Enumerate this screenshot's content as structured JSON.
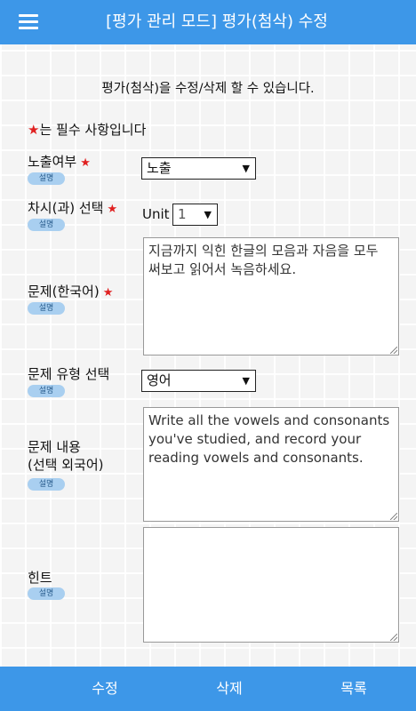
{
  "header": {
    "title": "[평가 관리 모드] 평가(첨삭) 수정",
    "menu_icon": "hamburger-menu-icon"
  },
  "intro_text": "평가(첨삭)을 수정/삭제 할 수 있습니다.",
  "required_note": {
    "star": "★",
    "text": "는 필수 사항입니다"
  },
  "help_label": "설명",
  "fields": {
    "exposure": {
      "label": "노출여부",
      "star": "★",
      "value": "노출"
    },
    "lesson": {
      "label": "차시(과) 선택",
      "star": "★",
      "unit_label": "Unit",
      "value": "1"
    },
    "question_ko": {
      "label": "문제(한국어)",
      "star": "★",
      "value": "지금까지 익힌 한글의 모음과 자음을 모두 써보고 읽어서 녹음하세요."
    },
    "question_type": {
      "label": "문제 유형 선택",
      "value": "영어"
    },
    "question_content": {
      "label_line1": "문제 내용",
      "label_line2": "(선택 외국어)",
      "value": "Write all the vowels and consonants you've studied, and record your reading vowels and consonants."
    },
    "hint": {
      "label": "힌트",
      "value": ""
    }
  },
  "dropdown_arrow": "▼",
  "footer": {
    "edit": "수정",
    "delete": "삭제",
    "list": "목록"
  },
  "colors": {
    "primary": "#3d97e8",
    "required_star": "#e02020",
    "help_badge": "#a9cff0"
  }
}
